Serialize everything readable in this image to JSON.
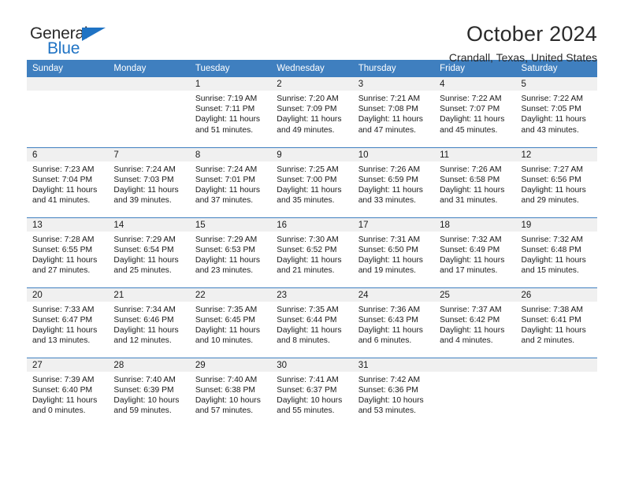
{
  "brand": {
    "name_top": "General",
    "name_bottom": "Blue"
  },
  "header": {
    "title": "October 2024",
    "subtitle": "Crandall, Texas, United States"
  },
  "colors": {
    "header_blue": "#3f7fbf",
    "brand_blue": "#1f73c4",
    "daynum_bg": "#f0f0f0",
    "text": "#1a1a1a"
  },
  "weekday_headers": [
    "Sunday",
    "Monday",
    "Tuesday",
    "Wednesday",
    "Thursday",
    "Friday",
    "Saturday"
  ],
  "weeks": [
    [
      {
        "day": "",
        "sunrise": "",
        "sunset": "",
        "daylight1": "",
        "daylight2": ""
      },
      {
        "day": "",
        "sunrise": "",
        "sunset": "",
        "daylight1": "",
        "daylight2": ""
      },
      {
        "day": "1",
        "sunrise": "Sunrise: 7:19 AM",
        "sunset": "Sunset: 7:11 PM",
        "daylight1": "Daylight: 11 hours",
        "daylight2": "and 51 minutes."
      },
      {
        "day": "2",
        "sunrise": "Sunrise: 7:20 AM",
        "sunset": "Sunset: 7:09 PM",
        "daylight1": "Daylight: 11 hours",
        "daylight2": "and 49 minutes."
      },
      {
        "day": "3",
        "sunrise": "Sunrise: 7:21 AM",
        "sunset": "Sunset: 7:08 PM",
        "daylight1": "Daylight: 11 hours",
        "daylight2": "and 47 minutes."
      },
      {
        "day": "4",
        "sunrise": "Sunrise: 7:22 AM",
        "sunset": "Sunset: 7:07 PM",
        "daylight1": "Daylight: 11 hours",
        "daylight2": "and 45 minutes."
      },
      {
        "day": "5",
        "sunrise": "Sunrise: 7:22 AM",
        "sunset": "Sunset: 7:05 PM",
        "daylight1": "Daylight: 11 hours",
        "daylight2": "and 43 minutes."
      }
    ],
    [
      {
        "day": "6",
        "sunrise": "Sunrise: 7:23 AM",
        "sunset": "Sunset: 7:04 PM",
        "daylight1": "Daylight: 11 hours",
        "daylight2": "and 41 minutes."
      },
      {
        "day": "7",
        "sunrise": "Sunrise: 7:24 AM",
        "sunset": "Sunset: 7:03 PM",
        "daylight1": "Daylight: 11 hours",
        "daylight2": "and 39 minutes."
      },
      {
        "day": "8",
        "sunrise": "Sunrise: 7:24 AM",
        "sunset": "Sunset: 7:01 PM",
        "daylight1": "Daylight: 11 hours",
        "daylight2": "and 37 minutes."
      },
      {
        "day": "9",
        "sunrise": "Sunrise: 7:25 AM",
        "sunset": "Sunset: 7:00 PM",
        "daylight1": "Daylight: 11 hours",
        "daylight2": "and 35 minutes."
      },
      {
        "day": "10",
        "sunrise": "Sunrise: 7:26 AM",
        "sunset": "Sunset: 6:59 PM",
        "daylight1": "Daylight: 11 hours",
        "daylight2": "and 33 minutes."
      },
      {
        "day": "11",
        "sunrise": "Sunrise: 7:26 AM",
        "sunset": "Sunset: 6:58 PM",
        "daylight1": "Daylight: 11 hours",
        "daylight2": "and 31 minutes."
      },
      {
        "day": "12",
        "sunrise": "Sunrise: 7:27 AM",
        "sunset": "Sunset: 6:56 PM",
        "daylight1": "Daylight: 11 hours",
        "daylight2": "and 29 minutes."
      }
    ],
    [
      {
        "day": "13",
        "sunrise": "Sunrise: 7:28 AM",
        "sunset": "Sunset: 6:55 PM",
        "daylight1": "Daylight: 11 hours",
        "daylight2": "and 27 minutes."
      },
      {
        "day": "14",
        "sunrise": "Sunrise: 7:29 AM",
        "sunset": "Sunset: 6:54 PM",
        "daylight1": "Daylight: 11 hours",
        "daylight2": "and 25 minutes."
      },
      {
        "day": "15",
        "sunrise": "Sunrise: 7:29 AM",
        "sunset": "Sunset: 6:53 PM",
        "daylight1": "Daylight: 11 hours",
        "daylight2": "and 23 minutes."
      },
      {
        "day": "16",
        "sunrise": "Sunrise: 7:30 AM",
        "sunset": "Sunset: 6:52 PM",
        "daylight1": "Daylight: 11 hours",
        "daylight2": "and 21 minutes."
      },
      {
        "day": "17",
        "sunrise": "Sunrise: 7:31 AM",
        "sunset": "Sunset: 6:50 PM",
        "daylight1": "Daylight: 11 hours",
        "daylight2": "and 19 minutes."
      },
      {
        "day": "18",
        "sunrise": "Sunrise: 7:32 AM",
        "sunset": "Sunset: 6:49 PM",
        "daylight1": "Daylight: 11 hours",
        "daylight2": "and 17 minutes."
      },
      {
        "day": "19",
        "sunrise": "Sunrise: 7:32 AM",
        "sunset": "Sunset: 6:48 PM",
        "daylight1": "Daylight: 11 hours",
        "daylight2": "and 15 minutes."
      }
    ],
    [
      {
        "day": "20",
        "sunrise": "Sunrise: 7:33 AM",
        "sunset": "Sunset: 6:47 PM",
        "daylight1": "Daylight: 11 hours",
        "daylight2": "and 13 minutes."
      },
      {
        "day": "21",
        "sunrise": "Sunrise: 7:34 AM",
        "sunset": "Sunset: 6:46 PM",
        "daylight1": "Daylight: 11 hours",
        "daylight2": "and 12 minutes."
      },
      {
        "day": "22",
        "sunrise": "Sunrise: 7:35 AM",
        "sunset": "Sunset: 6:45 PM",
        "daylight1": "Daylight: 11 hours",
        "daylight2": "and 10 minutes."
      },
      {
        "day": "23",
        "sunrise": "Sunrise: 7:35 AM",
        "sunset": "Sunset: 6:44 PM",
        "daylight1": "Daylight: 11 hours",
        "daylight2": "and 8 minutes."
      },
      {
        "day": "24",
        "sunrise": "Sunrise: 7:36 AM",
        "sunset": "Sunset: 6:43 PM",
        "daylight1": "Daylight: 11 hours",
        "daylight2": "and 6 minutes."
      },
      {
        "day": "25",
        "sunrise": "Sunrise: 7:37 AM",
        "sunset": "Sunset: 6:42 PM",
        "daylight1": "Daylight: 11 hours",
        "daylight2": "and 4 minutes."
      },
      {
        "day": "26",
        "sunrise": "Sunrise: 7:38 AM",
        "sunset": "Sunset: 6:41 PM",
        "daylight1": "Daylight: 11 hours",
        "daylight2": "and 2 minutes."
      }
    ],
    [
      {
        "day": "27",
        "sunrise": "Sunrise: 7:39 AM",
        "sunset": "Sunset: 6:40 PM",
        "daylight1": "Daylight: 11 hours",
        "daylight2": "and 0 minutes."
      },
      {
        "day": "28",
        "sunrise": "Sunrise: 7:40 AM",
        "sunset": "Sunset: 6:39 PM",
        "daylight1": "Daylight: 10 hours",
        "daylight2": "and 59 minutes."
      },
      {
        "day": "29",
        "sunrise": "Sunrise: 7:40 AM",
        "sunset": "Sunset: 6:38 PM",
        "daylight1": "Daylight: 10 hours",
        "daylight2": "and 57 minutes."
      },
      {
        "day": "30",
        "sunrise": "Sunrise: 7:41 AM",
        "sunset": "Sunset: 6:37 PM",
        "daylight1": "Daylight: 10 hours",
        "daylight2": "and 55 minutes."
      },
      {
        "day": "31",
        "sunrise": "Sunrise: 7:42 AM",
        "sunset": "Sunset: 6:36 PM",
        "daylight1": "Daylight: 10 hours",
        "daylight2": "and 53 minutes."
      },
      {
        "day": "",
        "sunrise": "",
        "sunset": "",
        "daylight1": "",
        "daylight2": ""
      },
      {
        "day": "",
        "sunrise": "",
        "sunset": "",
        "daylight1": "",
        "daylight2": ""
      }
    ]
  ]
}
